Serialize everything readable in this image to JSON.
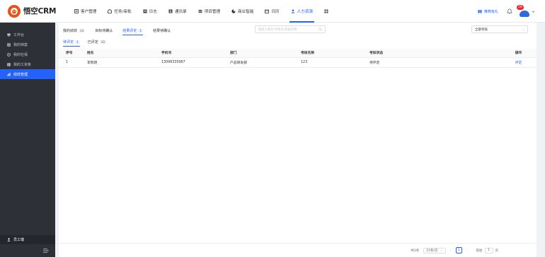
{
  "app": {
    "name": "悟空CRM"
  },
  "nav": [
    {
      "label": "客户管理",
      "icon": "customer-icon"
    },
    {
      "label": "任务/审批",
      "icon": "task-icon"
    },
    {
      "label": "日志",
      "icon": "log-icon"
    },
    {
      "label": "通讯录",
      "icon": "contacts-icon"
    },
    {
      "label": "项目管理",
      "icon": "project-icon"
    },
    {
      "label": "商业智能",
      "icon": "bi-icon"
    },
    {
      "label": "日历",
      "icon": "calendar-icon"
    },
    {
      "label": "人力资源",
      "icon": "hr-icon",
      "active": true
    }
  ],
  "topright": {
    "invite_label": "推荐有礼",
    "badge": "26"
  },
  "sidebar": {
    "items": [
      {
        "label": "工作台"
      },
      {
        "label": "我的档案"
      },
      {
        "label": "我的社保"
      },
      {
        "label": "我的工资条"
      },
      {
        "label": "绩效管理",
        "active": true
      }
    ],
    "staff_label": "员工端"
  },
  "tabs": [
    {
      "label": "我的绩效",
      "count": "14"
    },
    {
      "label": "目标待确认",
      "count": ""
    },
    {
      "label": "结果评定",
      "count": "1",
      "active": true
    },
    {
      "label": "结果待确认",
      "count": ""
    }
  ],
  "search": {
    "placeholder": "搜索人姓名/手机号/考核名称"
  },
  "select": {
    "value": "全部考核"
  },
  "subtabs": [
    {
      "label": "待评定",
      "count": "1",
      "active": true
    },
    {
      "label": "已评定",
      "count": "10"
    }
  ],
  "table": {
    "headers": [
      "序号",
      "姓名",
      "手机号",
      "部门",
      "考核名称",
      "考核状态",
      "操作"
    ],
    "rows": [
      [
        "1",
        "李晓艳",
        "13096335967",
        "产品研发部",
        "123",
        "待评定",
        "评定"
      ]
    ]
  },
  "pager": {
    "total": "共1条",
    "page_size": "15条/页",
    "current": "1",
    "goto_label": "前往",
    "goto_value": "1",
    "goto_unit": "页"
  },
  "colors": {
    "accent": "#2362fb",
    "sidebar_bg": "#2d3037",
    "logo": "#e7521b"
  }
}
